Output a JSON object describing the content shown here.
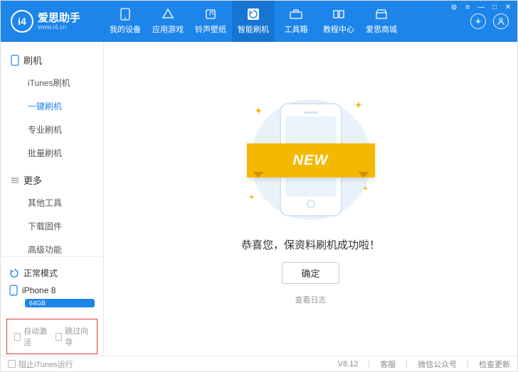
{
  "brand": {
    "name": "爱思助手",
    "url": "www.i4.cn",
    "logo_letters": "i4"
  },
  "nav": {
    "items": [
      {
        "label": "我的设备",
        "icon": "phone"
      },
      {
        "label": "应用游戏",
        "icon": "apps"
      },
      {
        "label": "铃声壁纸",
        "icon": "music"
      },
      {
        "label": "智能刷机",
        "icon": "refresh",
        "active": true
      },
      {
        "label": "工具箱",
        "icon": "toolbox"
      },
      {
        "label": "教程中心",
        "icon": "book"
      },
      {
        "label": "爱思商城",
        "icon": "shop"
      }
    ]
  },
  "win": {
    "settings": "⚙",
    "menu": "≡",
    "min": "—",
    "max": "□",
    "close": "✕"
  },
  "sidebar": {
    "groups": [
      {
        "title": "刷机",
        "items": [
          {
            "label": "iTunes刷机"
          },
          {
            "label": "一键刷机",
            "active": true
          },
          {
            "label": "专业刷机"
          },
          {
            "label": "批量刷机"
          }
        ]
      },
      {
        "title": "更多",
        "items": [
          {
            "label": "其他工具"
          },
          {
            "label": "下载固件"
          },
          {
            "label": "高级功能"
          }
        ]
      }
    ],
    "mode": {
      "label": "正常模式"
    },
    "device": {
      "name": "iPhone 8",
      "storage": "64GB"
    },
    "checks": {
      "auto_activate": "自动激活",
      "skip_wizard": "跳过向导"
    }
  },
  "main": {
    "ribbon": "NEW",
    "message": "恭喜您，保资料刷机成功啦！",
    "ok_label": "确定",
    "log_link": "查看日志"
  },
  "footer": {
    "block_itunes": "阻止iTunes运行",
    "version": "V8.12",
    "support": "客服",
    "wechat": "微信公众号",
    "update": "检查更新"
  }
}
